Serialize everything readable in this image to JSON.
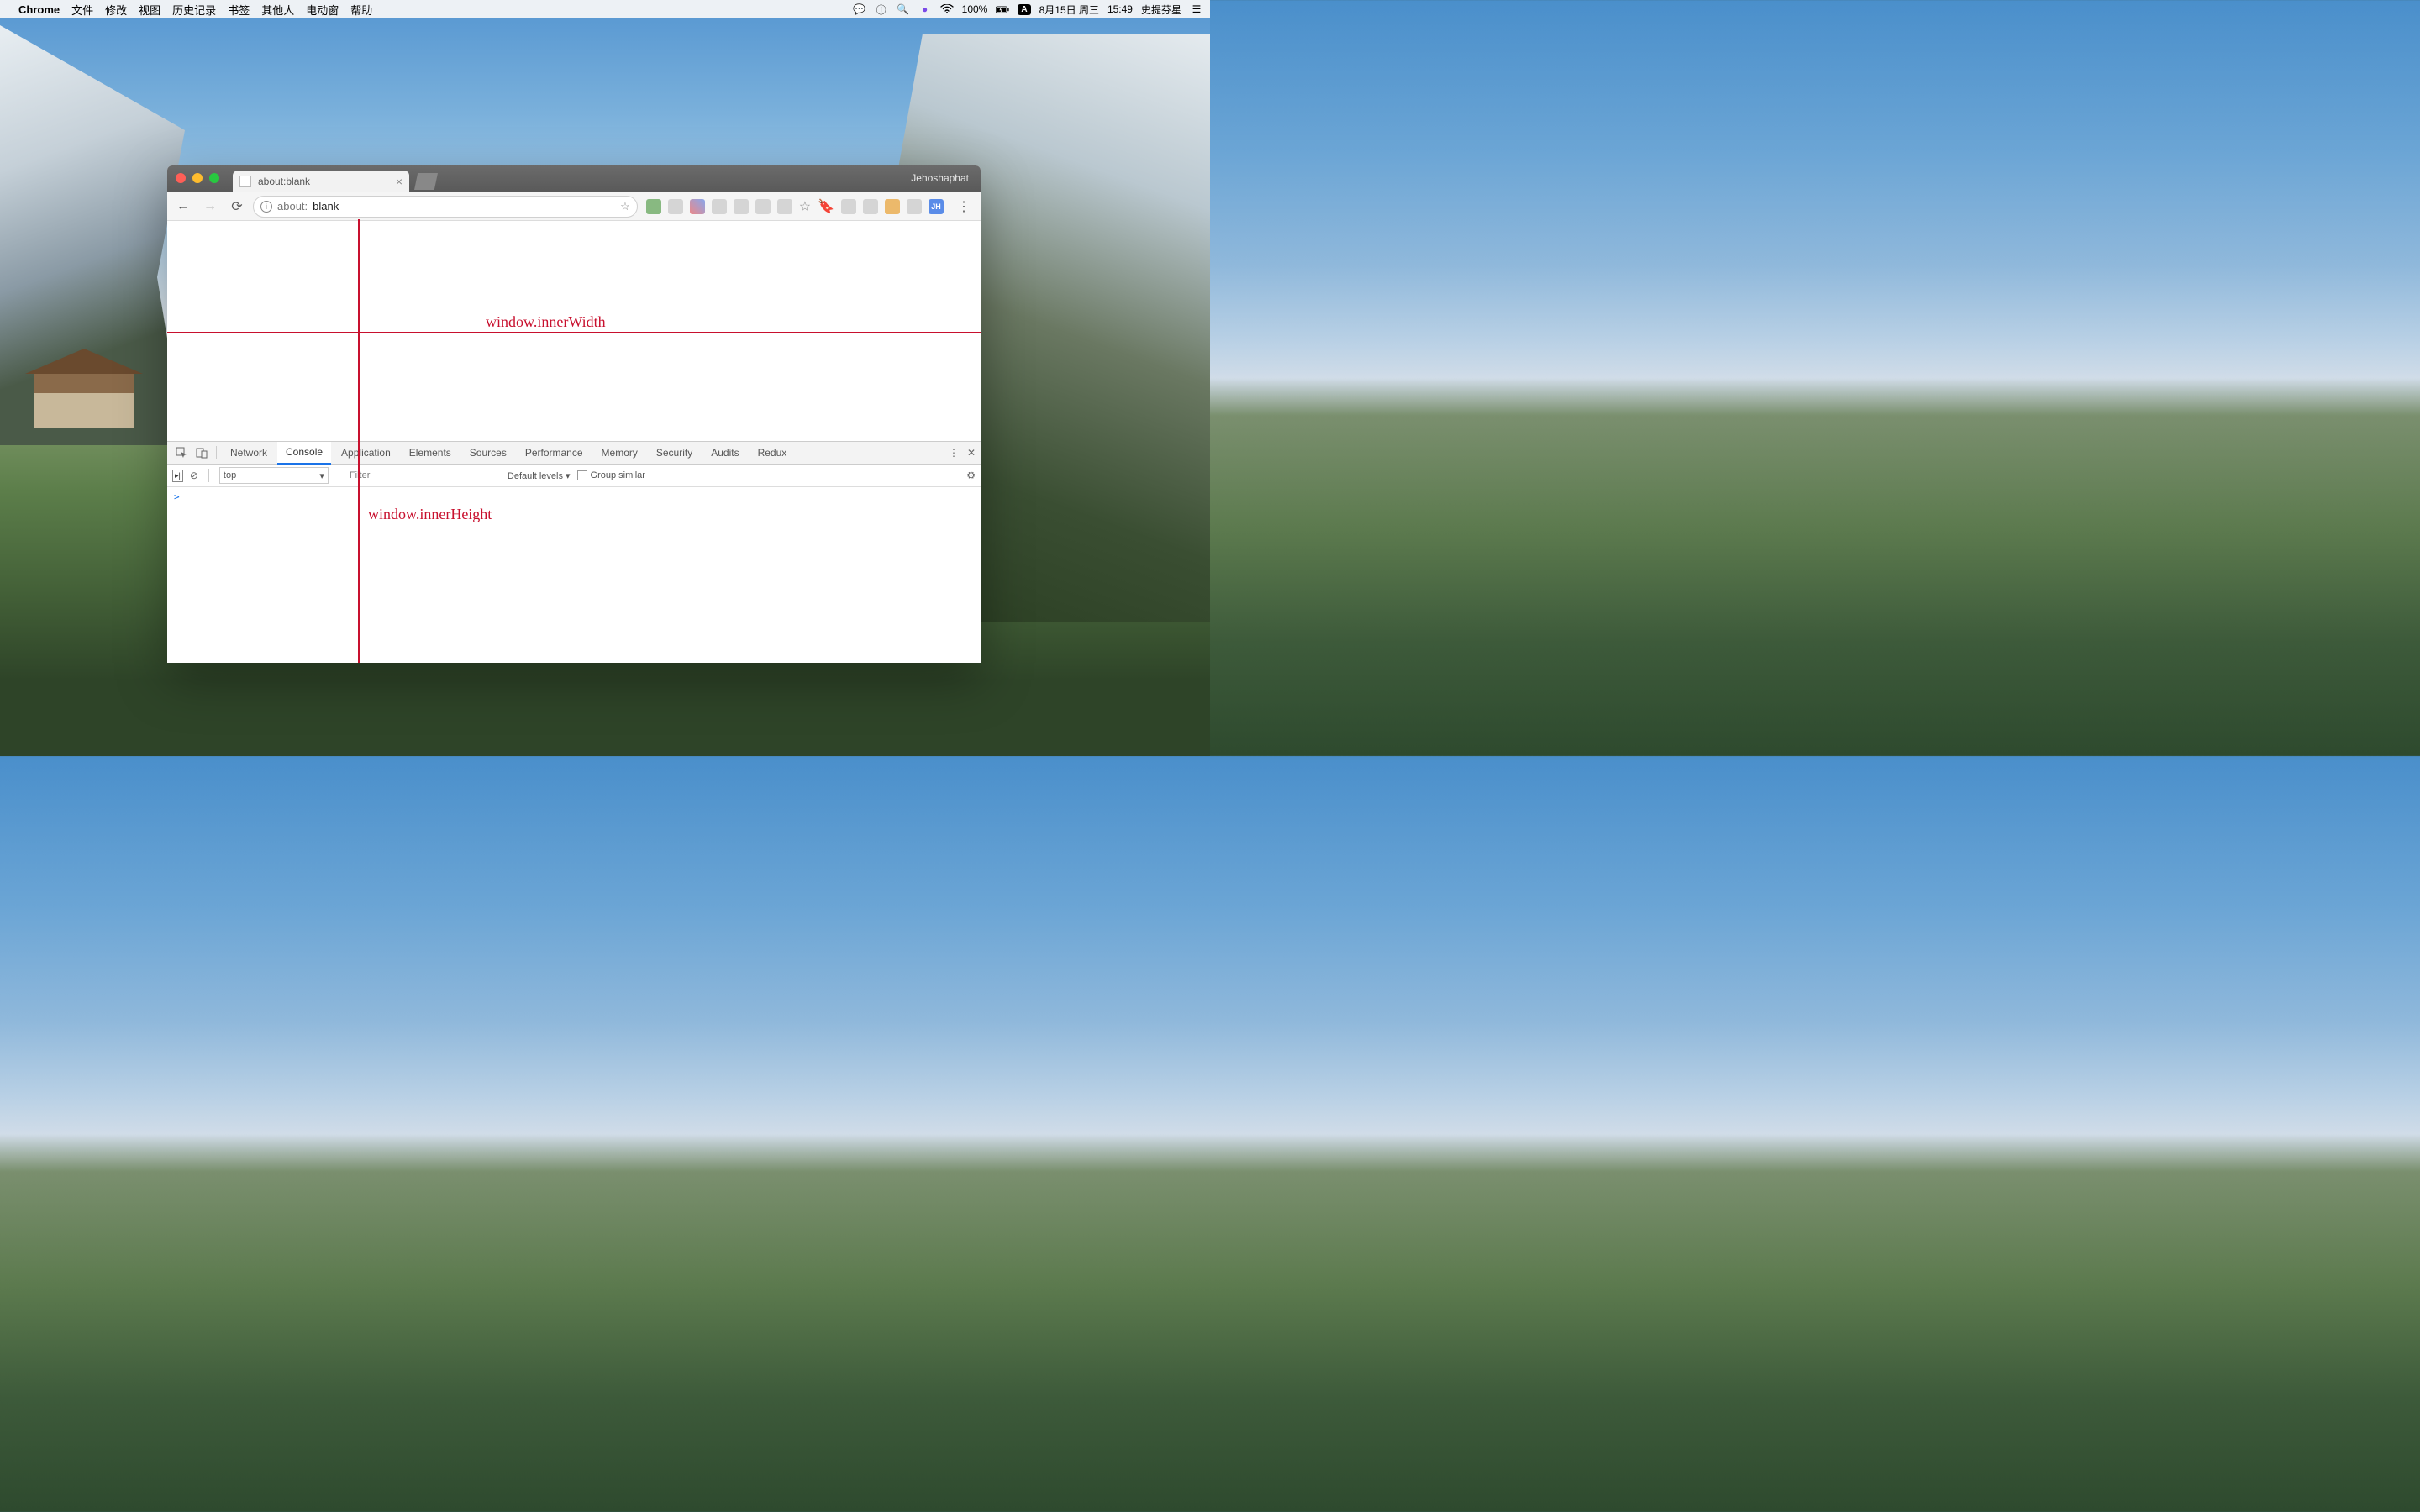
{
  "menubar": {
    "apple": "",
    "appname": "Chrome",
    "items": [
      "文件",
      "修改",
      "视图",
      "历史记录",
      "书签",
      "其他人",
      "电动窗",
      "帮助"
    ],
    "battery": "100%",
    "input_badge": "A",
    "date": "8月15日 周三",
    "time": "15:49",
    "user": "史提芬星"
  },
  "chrome": {
    "tab_title": "about:blank",
    "profile": "Jehoshaphat",
    "url_prefix": "about:",
    "url_path": "blank",
    "ext_jh": "JH"
  },
  "devtools": {
    "tabs": [
      "Network",
      "Console",
      "Application",
      "Elements",
      "Sources",
      "Performance",
      "Memory",
      "Security",
      "Audits",
      "Redux"
    ],
    "active_tab": "Console",
    "context": "top",
    "filter_placeholder": "Filter",
    "levels_label": "Default levels ▾",
    "group_label": "Group similar",
    "prompt": ">"
  },
  "annotations": {
    "width_label": "window.innerWidth",
    "height_label": "window.innerHeight"
  }
}
